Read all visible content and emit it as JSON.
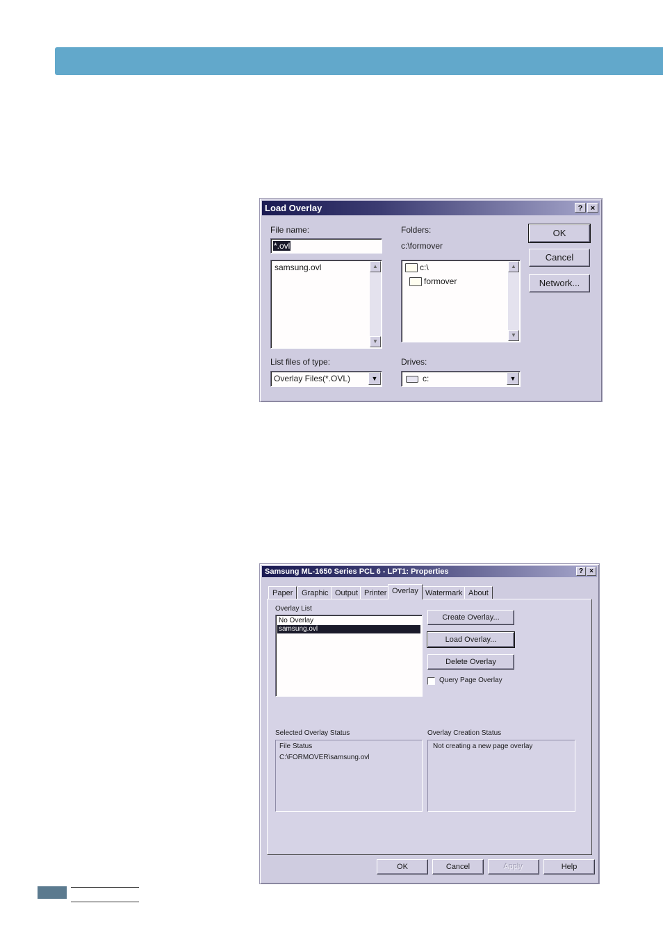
{
  "load_overlay": {
    "title": "Load Overlay",
    "help_btn": "?",
    "close_btn": "×",
    "file_name_label": "File name:",
    "file_name_value": "*.ovl",
    "files": [
      "samsung.ovl"
    ],
    "folders_label": "Folders:",
    "folders_path": "c:\\formover",
    "folder_tree": [
      "c:\\",
      "formover"
    ],
    "ok_label": "OK",
    "cancel_label": "Cancel",
    "network_label": "Network...",
    "list_type_label": "List files of type:",
    "list_type_value": "Overlay Files(*.OVL)",
    "drives_label": "Drives:",
    "drives_value": "c:"
  },
  "properties": {
    "title": "Samsung ML-1650 Series PCL 6 - LPT1: Properties",
    "help_btn": "?",
    "close_btn": "×",
    "tabs": [
      "Paper",
      "Graphic",
      "Output",
      "Printer",
      "Overlay",
      "Watermark",
      "About"
    ],
    "active_tab": "Overlay",
    "overlay_list_label": "Overlay List",
    "overlay_list": [
      "No Overlay",
      "samsung.ovl"
    ],
    "selected_overlay": "samsung.ovl",
    "create_overlay": "Create Overlay...",
    "load_overlay": "Load Overlay...",
    "delete_overlay": "Delete Overlay",
    "query_page_overlay": "Query Page Overlay",
    "selected_status_label": "Selected Overlay Status",
    "file_status_label": "File Status",
    "file_status_value": "C:\\FORMOVER\\samsung.ovl",
    "creation_status_label": "Overlay Creation Status",
    "creation_status_value": "Not creating a new page overlay",
    "ok_label": "OK",
    "cancel_label": "Cancel",
    "apply_label": "Apply",
    "help_label": "Help"
  }
}
